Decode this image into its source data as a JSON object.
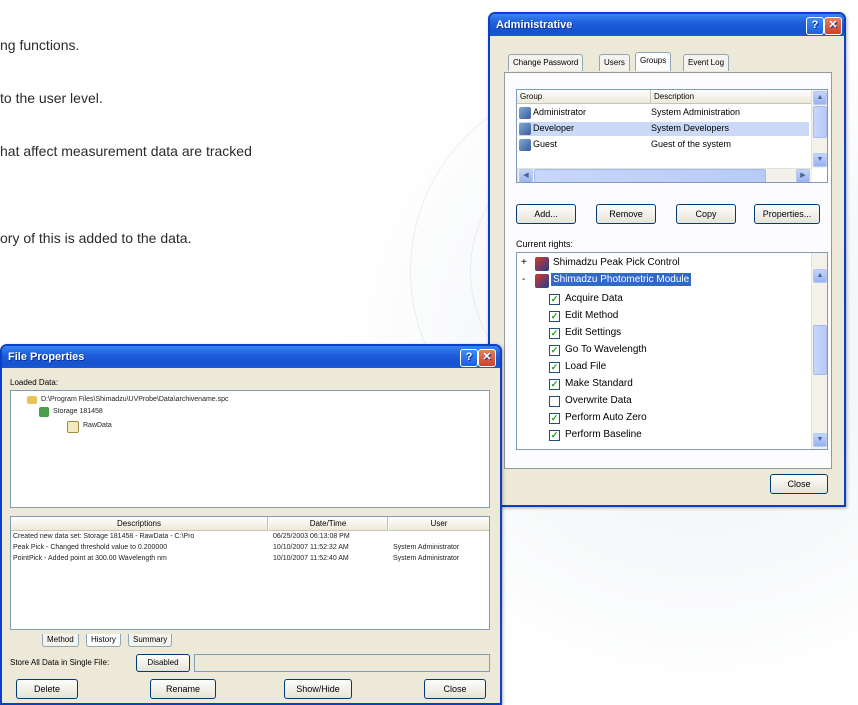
{
  "doc": {
    "lines": [
      "ng functions.",
      " to the user level.",
      "hat affect measurement data are tracked",
      "ory of this is added to the data."
    ]
  },
  "admin": {
    "title": "Administrative",
    "tabs": [
      "Change Password",
      "Users",
      "Groups",
      "Event Log"
    ],
    "active_tab": "Groups",
    "table_headers": [
      "Group",
      "Description"
    ],
    "groups": [
      {
        "name": "Administrator",
        "description": "System Administration"
      },
      {
        "name": "Developer",
        "description": "System Developers"
      },
      {
        "name": "Guest",
        "description": "Guest of the system"
      }
    ],
    "buttons": [
      "Add...",
      "Remove",
      "Copy",
      "Properties..."
    ],
    "rights_label": "Current rights:",
    "rights_tree": [
      {
        "label": "Shimadzu Peak Pick Control",
        "level": 0,
        "expander": "+"
      },
      {
        "label": "Shimadzu Photometric Module",
        "level": 0,
        "expander": "-",
        "selected": true
      }
    ],
    "rights": [
      {
        "label": "Acquire Data",
        "checked": true
      },
      {
        "label": "Edit Method",
        "checked": true
      },
      {
        "label": "Edit Settings",
        "checked": true
      },
      {
        "label": "Go To Wavelength",
        "checked": true
      },
      {
        "label": "Load File",
        "checked": true
      },
      {
        "label": "Make Standard",
        "checked": true
      },
      {
        "label": "Overwrite Data",
        "checked": false
      },
      {
        "label": "Perform Auto Zero",
        "checked": true
      },
      {
        "label": "Perform Baseline",
        "checked": true
      }
    ],
    "close_label": "Close"
  },
  "fileprops": {
    "title": "File Properties",
    "loaded_label": "Loaded Data:",
    "tree": [
      {
        "label": "D:\\Program Files\\Shimadzu\\UVProbe\\Data\\archivename.spc",
        "level": 0
      },
      {
        "label": "Storage 181458",
        "level": 1
      },
      {
        "label": "RawData",
        "level": 2
      }
    ],
    "table_headers": [
      "Descriptions",
      "Date/Time",
      "User"
    ],
    "history": [
      {
        "desc": "Created new data set: Storage 181458 - RawData - C:\\Pro",
        "date": "06/25/2003 06:13:08 PM",
        "user": ""
      },
      {
        "desc": "Peak Pick - Changed threshold value to 0.200000",
        "date": "10/10/2007 11:52:32 AM",
        "user": "System Administrator"
      },
      {
        "desc": "PointPick - Added point at 300.00 Wavelength nm",
        "date": "10/10/2007 11:52:40 AM",
        "user": "System Administrator"
      }
    ],
    "tabs": [
      "Method",
      "History",
      "Summary"
    ],
    "store_label": "Store All Data in Single File:",
    "store_value": "Disabled",
    "buttons": [
      "Delete",
      "Rename",
      "Show/Hide",
      "Close"
    ]
  }
}
